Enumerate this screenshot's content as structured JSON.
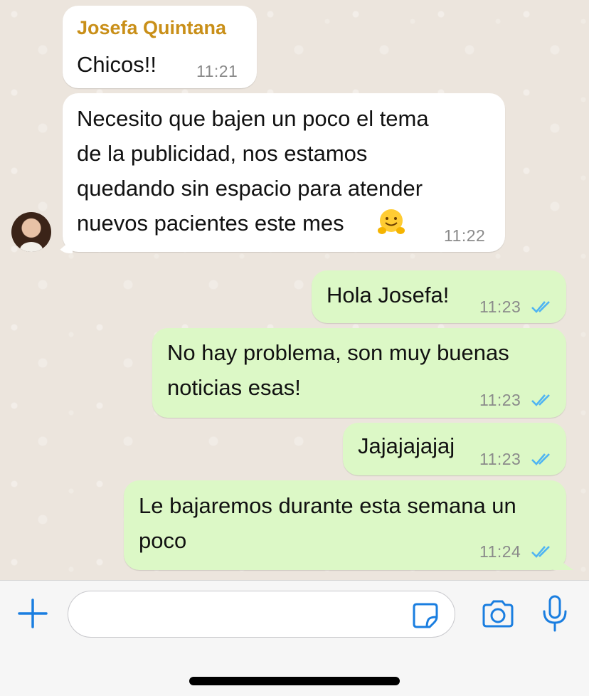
{
  "messages": [
    {
      "sender": "Josefa Quintana",
      "text": "Chicos!!",
      "time": "11:21"
    },
    {
      "text": "Necesito que bajen un poco el tema\nde la publicidad, nos estamos\nquedando sin espacio para atender\nnuevos pacientes este mes",
      "time": "11:22",
      "emoji": "hugging-face"
    },
    {
      "text": "Hola Josefa!",
      "time": "11:23",
      "status": "read"
    },
    {
      "text": "No hay problema, son muy buenas\nnoticias esas!",
      "time": "11:23",
      "status": "read"
    },
    {
      "text": "Jajajajajaj",
      "time": "11:23",
      "status": "read"
    },
    {
      "text": "Le bajaremos durante esta semana un\npoco",
      "time": "11:24",
      "status": "read"
    }
  ],
  "composer": {
    "placeholder": "",
    "value": ""
  },
  "icons": [
    "plus-icon",
    "sticker-icon",
    "camera-icon",
    "microphone-icon",
    "double-check-icon"
  ],
  "colors": {
    "accent": "#1a7ee0",
    "sender": "#c98f18",
    "outgoing": "#dcf8c6",
    "ticks": "#4fb4f2"
  }
}
